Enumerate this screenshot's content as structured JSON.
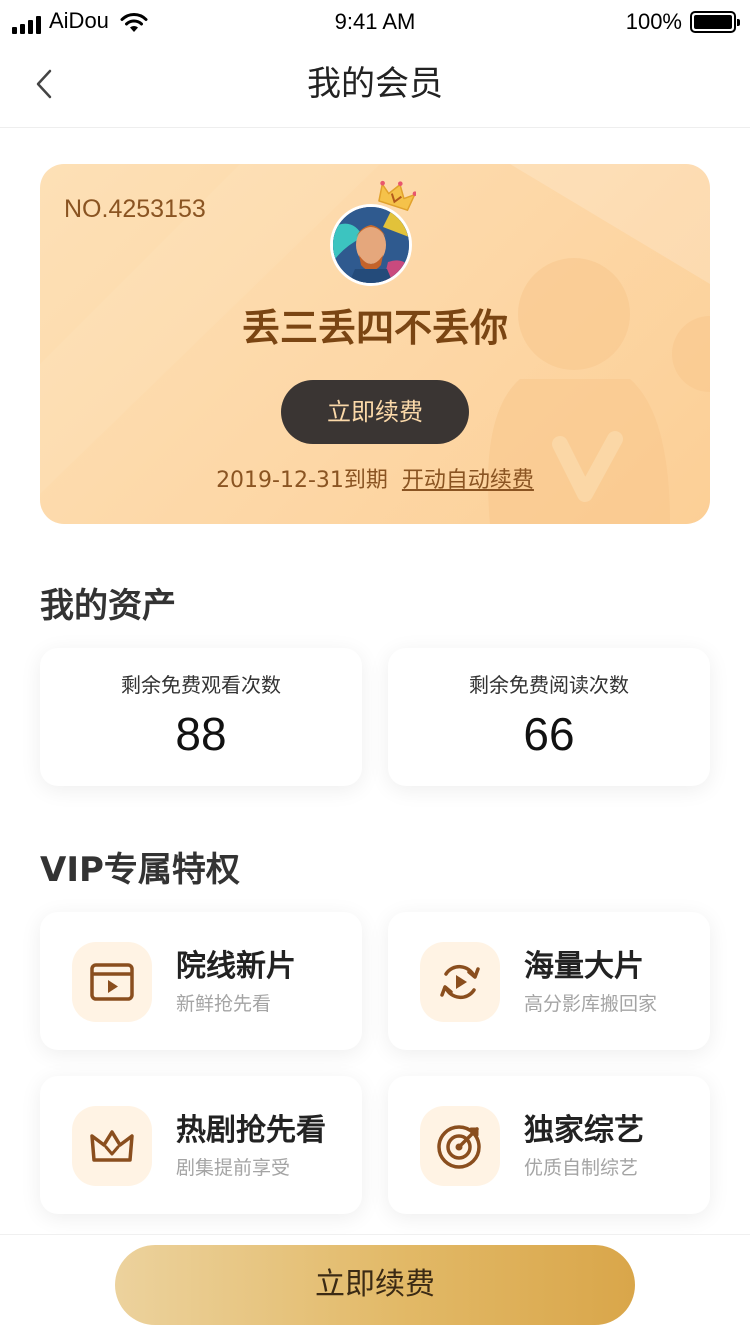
{
  "status_bar": {
    "carrier": "AiDou",
    "time": "9:41 AM",
    "battery": "100%"
  },
  "nav": {
    "title": "我的会员"
  },
  "member_card": {
    "number": "NO.4253153",
    "username": "丢三丢四不丢你",
    "renew_button": "立即续费",
    "expire_text": "2019-12-31到期",
    "auto_renew_link": "开动自动续费"
  },
  "assets": {
    "title": "我的资产",
    "items": [
      {
        "label": "剩余免费观看次数",
        "value": "88"
      },
      {
        "label": "剩余免费阅读次数",
        "value": "66"
      }
    ]
  },
  "privileges": {
    "title": "VIP专属特权",
    "items": [
      {
        "icon": "cinema-icon",
        "title": "院线新片",
        "subtitle": "新鲜抢先看"
      },
      {
        "icon": "refresh-play-icon",
        "title": "海量大片",
        "subtitle": "高分影库搬回家"
      },
      {
        "icon": "crown-icon",
        "title": "热剧抢先看",
        "subtitle": "剧集提前享受"
      },
      {
        "icon": "target-icon",
        "title": "独家综艺",
        "subtitle": "优质自制综艺"
      }
    ]
  },
  "bottom_bar": {
    "renew_button": "立即续费"
  },
  "colors": {
    "card_bg": "#fdd7a6",
    "card_text": "#8a5422",
    "icon_brown": "#8a4e1e",
    "icon_bg": "#fff3e4",
    "button_gold": "#e2b967"
  }
}
